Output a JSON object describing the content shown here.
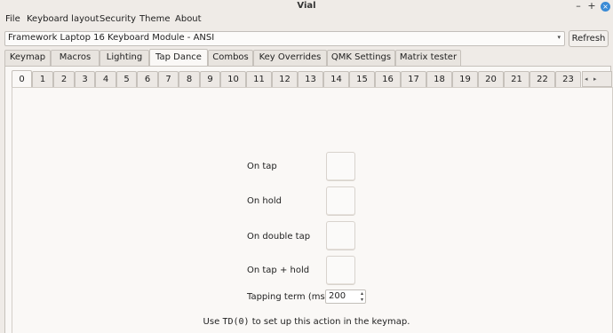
{
  "window": {
    "title": "Vial",
    "minimize": "–",
    "maximize": "+",
    "close": "×"
  },
  "menu": [
    "File",
    "Keyboard layout",
    "Security",
    "Theme",
    "About"
  ],
  "device_selector": {
    "value": "Framework Laptop 16 Keyboard Module - ANSI",
    "arrow": "▾"
  },
  "refresh_label": "Refresh",
  "tabs": [
    "Keymap",
    "Macros",
    "Lighting",
    "Tap Dance",
    "Combos",
    "Key Overrides",
    "QMK Settings",
    "Matrix tester"
  ],
  "active_tab": "Tap Dance",
  "subtabs": [
    "0",
    "1",
    "2",
    "3",
    "4",
    "5",
    "6",
    "7",
    "8",
    "9",
    "10",
    "11",
    "12",
    "13",
    "14",
    "15",
    "16",
    "17",
    "18",
    "19",
    "20",
    "21",
    "22",
    "23"
  ],
  "active_subtab": "0",
  "subtab_scroll": {
    "left": "◂",
    "right": "▸"
  },
  "fields": {
    "on_tap": "On tap",
    "on_hold": "On hold",
    "on_double_tap": "On double tap",
    "on_tap_hold": "On tap + hold",
    "tapping_term_label": "Tapping term (ms)",
    "tapping_term_value": "200"
  },
  "spin_arrows": {
    "up": "▴",
    "down": "▾"
  },
  "hint": {
    "prefix": "Use ",
    "code": "TD(0)",
    "suffix": " to set up this action in the keymap."
  }
}
